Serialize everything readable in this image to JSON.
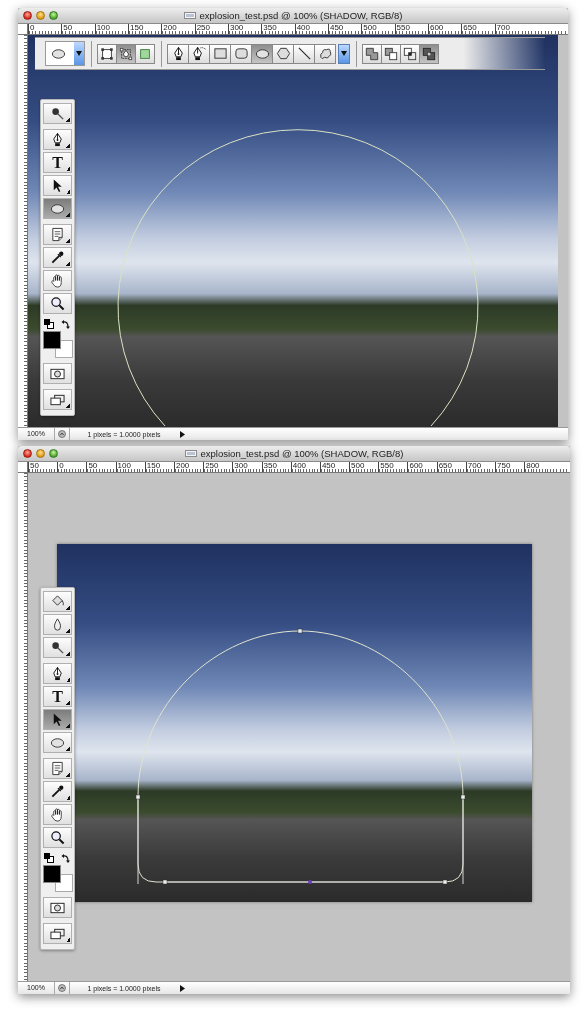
{
  "windows": [
    {
      "title": "explosion_test.psd @ 100% (SHADOW, RGB/8)",
      "ruler_labels": [
        "0",
        "50",
        "100",
        "150",
        "200",
        "250",
        "300",
        "350",
        "400",
        "450",
        "500",
        "550",
        "600",
        "650",
        "700"
      ],
      "options_bar": {
        "modes": [
          {
            "kind": "layers",
            "selected": false
          },
          {
            "kind": "paths",
            "selected": true
          },
          {
            "kind": "pixels",
            "selected": false
          }
        ],
        "shapes": [
          {
            "kind": "pen",
            "selected": false
          },
          {
            "kind": "freeform",
            "selected": false
          },
          {
            "kind": "rectangle",
            "selected": false
          },
          {
            "kind": "rounded",
            "selected": false
          },
          {
            "kind": "ellipse",
            "selected": true
          },
          {
            "kind": "polygon",
            "selected": false
          },
          {
            "kind": "line",
            "selected": false
          },
          {
            "kind": "custom",
            "selected": false
          }
        ],
        "path_ops": [
          {
            "kind": "add",
            "selected": false
          },
          {
            "kind": "subtract",
            "selected": false
          },
          {
            "kind": "intersect",
            "selected": false
          },
          {
            "kind": "exclude",
            "selected": true
          }
        ]
      },
      "toolbar": {
        "groups": [
          [
            {
              "kind": "wand",
              "selected": false
            }
          ],
          [
            {
              "kind": "pen",
              "selected": false
            },
            {
              "kind": "type",
              "label": "T",
              "selected": false
            },
            {
              "kind": "arrow",
              "selected": false
            },
            {
              "kind": "ellipse",
              "selected": true
            }
          ],
          [
            {
              "kind": "notes",
              "selected": false
            },
            {
              "kind": "eyedropper",
              "selected": false
            },
            {
              "kind": "hand",
              "selected": false
            },
            {
              "kind": "zoom",
              "selected": false
            }
          ]
        ]
      },
      "canvas": {
        "kind": "fill"
      },
      "status": {
        "zoom": "100%",
        "info": "1 pixels = 1.0000 pixels"
      }
    },
    {
      "title": "explosion_test.psd @ 100% (SHADOW, RGB/8)",
      "ruler_labels": [
        "50",
        "0",
        "50",
        "100",
        "150",
        "200",
        "250",
        "300",
        "350",
        "400",
        "450",
        "500",
        "550",
        "600",
        "650",
        "700",
        "750",
        "800"
      ],
      "toolbar": {
        "groups": [
          [
            {
              "kind": "bucket",
              "selected": false
            },
            {
              "kind": "blur",
              "selected": false
            },
            {
              "kind": "wand",
              "selected": false
            }
          ],
          [
            {
              "kind": "pen",
              "selected": false
            },
            {
              "kind": "type",
              "label": "T",
              "selected": false
            },
            {
              "kind": "arrow",
              "selected": true
            },
            {
              "kind": "ellipse",
              "selected": false
            }
          ],
          [
            {
              "kind": "notes",
              "selected": false
            },
            {
              "kind": "eyedropper",
              "selected": false
            },
            {
              "kind": "hand",
              "selected": false
            },
            {
              "kind": "zoom",
              "selected": false
            }
          ]
        ]
      },
      "canvas": {
        "kind": "framed"
      },
      "status": {
        "zoom": "100%",
        "info": "1 pixels = 1.0000 pixels"
      }
    }
  ]
}
